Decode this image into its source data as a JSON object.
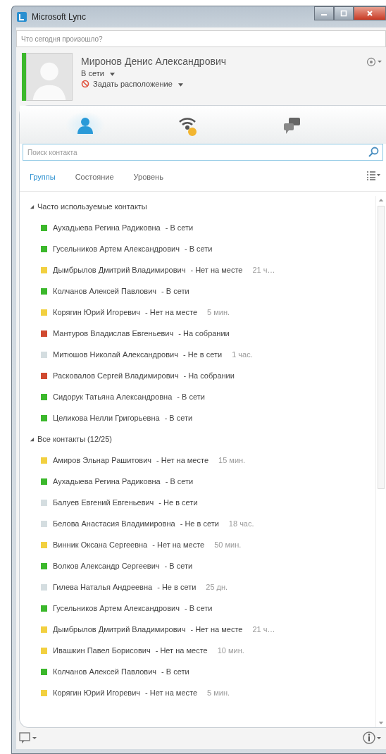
{
  "window": {
    "title": "Microsoft Lync"
  },
  "status_note": {
    "placeholder": "Что сегодня произошло?"
  },
  "profile": {
    "name": "Миронов Денис Александрович",
    "presence": "В сети",
    "color": "#3cb82c",
    "location": "Задать расположение"
  },
  "nav_tabs": [
    {
      "kind": "contacts",
      "selected": true
    },
    {
      "kind": "activity",
      "selected": false
    },
    {
      "kind": "conversations",
      "selected": false
    }
  ],
  "search": {
    "placeholder": "Поиск контакта"
  },
  "view_tabs": [
    {
      "label": "Группы",
      "selected": true
    },
    {
      "label": "Состояние",
      "selected": false
    },
    {
      "label": "Уровень",
      "selected": false
    }
  ],
  "groups": [
    {
      "title": "Часто используемые контакты",
      "expanded": true,
      "contacts": [
        {
          "name": "Аухадыева Регина Радиковна",
          "status": "- В сети",
          "color": "#3cb82c"
        },
        {
          "name": "Гусельников Артем Александрович",
          "status": "- В сети",
          "color": "#3cb82c"
        },
        {
          "name": "Дымбрылов Дмитрий Владимирович",
          "status": "- Нет на месте",
          "time": "21 ч…",
          "color": "#f2d040"
        },
        {
          "name": "Колчанов Алексей Павлович",
          "status": "- В сети",
          "color": "#3cb82c"
        },
        {
          "name": "Корягин Юрий Игоревич",
          "status": "- Нет на месте",
          "time": "5 мин.",
          "color": "#f2d040"
        },
        {
          "name": "Мантуров Владислав Евгеньевич",
          "status": "- На собрании",
          "color": "#d04a30"
        },
        {
          "name": "Митюшов Николай Александрович",
          "status": "- Не в сети",
          "time": "1 час.",
          "color": "#d4dde0"
        },
        {
          "name": "Расковалов Сергей Владимирович",
          "status": "- На собрании",
          "color": "#d04a30"
        },
        {
          "name": "Сидорук Татьяна Александровна",
          "status": "- В сети",
          "color": "#3cb82c"
        },
        {
          "name": "Целикова Нелли Григорьевна",
          "status": "- В сети",
          "color": "#3cb82c"
        }
      ]
    },
    {
      "title": "Все контакты (12/25)",
      "expanded": true,
      "contacts": [
        {
          "name": "Амиров Эльнар Рашитович",
          "status": "- Нет на месте",
          "time": "15 мин.",
          "color": "#f2d040"
        },
        {
          "name": "Аухадыева Регина Радиковна",
          "status": "- В сети",
          "color": "#3cb82c"
        },
        {
          "name": "Балуев Евгений Евгеньевич",
          "status": "- Не в сети",
          "color": "#d4dde0"
        },
        {
          "name": "Белова Анастасия Владимировна",
          "status": "- Не в сети",
          "time": "18 час.",
          "color": "#d4dde0"
        },
        {
          "name": "Винник Оксана Сергеевна",
          "status": "- Нет на месте",
          "time": "50 мин.",
          "color": "#f2d040"
        },
        {
          "name": "Волков Александр Сергеевич",
          "status": "- В сети",
          "color": "#3cb82c"
        },
        {
          "name": "Гилева Наталья Андреевна",
          "status": "- Не в сети",
          "time": "25 дн.",
          "color": "#d4dde0"
        },
        {
          "name": "Гусельников Артем Александрович",
          "status": "- В сети",
          "color": "#3cb82c"
        },
        {
          "name": "Дымбрылов Дмитрий Владимирович",
          "status": "- Нет на месте",
          "time": "21 ч…",
          "color": "#f2d040"
        },
        {
          "name": "Ивашкин Павел Борисович",
          "status": "- Нет на месте",
          "time": "10 мин.",
          "color": "#f2d040"
        },
        {
          "name": "Колчанов Алексей Павлович",
          "status": "- В сети",
          "color": "#3cb82c"
        },
        {
          "name": "Корягин Юрий Игоревич",
          "status": "- Нет на месте",
          "time": "5 мин.",
          "color": "#f2d040"
        }
      ]
    }
  ]
}
